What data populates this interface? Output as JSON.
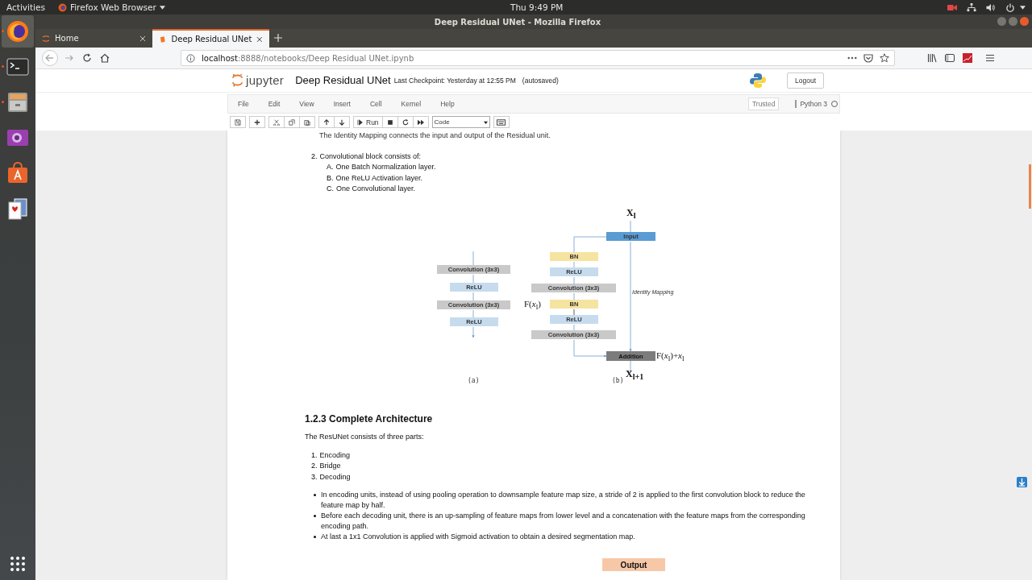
{
  "topbar": {
    "activities": "Activities",
    "app_menu": "Firefox Web Browser",
    "clock": "Thu  9:49 PM"
  },
  "dock": [
    {
      "kind": "firefox",
      "selected": true,
      "running": true
    },
    {
      "kind": "terminal",
      "selected": false,
      "running": true
    },
    {
      "kind": "files",
      "selected": false,
      "running": true
    },
    {
      "kind": "video",
      "selected": false,
      "running": false
    },
    {
      "kind": "software",
      "selected": false,
      "running": false
    },
    {
      "kind": "cards",
      "selected": false,
      "running": false
    }
  ],
  "window": {
    "title": "Deep Residual UNet - Mozilla Firefox"
  },
  "tabs": [
    {
      "label": "Home",
      "selected": false
    },
    {
      "label": "Deep Residual UNet",
      "selected": true
    }
  ],
  "address": {
    "host": "localhost",
    "path": ":8888/notebooks/Deep Residual UNet.ipynb"
  },
  "jupyter": {
    "logo_text": "jupyter",
    "notebook_name": "Deep Residual UNet",
    "checkpoint": "Last Checkpoint: Yesterday at 12:55 PM",
    "autosave": "(autosaved)",
    "logout": "Logout",
    "menus": [
      "File",
      "Edit",
      "View",
      "Insert",
      "Cell",
      "Kernel",
      "Help"
    ],
    "trusted": "Trusted",
    "kernel": "Python 3",
    "run": "Run",
    "cell_type": "Code"
  },
  "notebook": {
    "intro": "The Identity Mapping connects the input and output of the Residual unit.",
    "item2": {
      "number": "2.",
      "text": "Convolutional block consists of:",
      "subitems": [
        {
          "mark": "A.",
          "text": "One Batch Normalization layer."
        },
        {
          "mark": "B.",
          "text": "One ReLU Activation layer."
        },
        {
          "mark": "C.",
          "text": "One Convolutional layer."
        }
      ]
    },
    "diagram": {
      "panel_a": {
        "caption": "(a)",
        "blocks": [
          {
            "kind": "conv",
            "label": "Convolution (3x3)"
          },
          {
            "kind": "relu",
            "label": "ReLU"
          },
          {
            "kind": "conv",
            "label": "Convolution (3x3)"
          },
          {
            "kind": "relu",
            "label": "ReLU"
          }
        ]
      },
      "panel_b": {
        "caption": "(b)",
        "input_symbol": "X$_{l}$",
        "input": "Input",
        "residual_label": "F(*x*$_{l}$)",
        "identity_label": "Identity Mapping",
        "addition": "Addition",
        "sum_label": "F(*x*$_{l}$)+*x*$_{l}$",
        "output_symbol": "X$_{l+1}$",
        "blocks": [
          {
            "kind": "bn",
            "label": "BN"
          },
          {
            "kind": "relu",
            "label": "ReLU"
          },
          {
            "kind": "conv",
            "label": "Convolution (3x3)"
          },
          {
            "kind": "bn",
            "label": "BN"
          },
          {
            "kind": "relu",
            "label": "ReLU"
          },
          {
            "kind": "conv",
            "label": "Convolution (3x3)"
          }
        ]
      }
    },
    "heading": "1.2.3 Complete Architecture",
    "paragraph": "The ResUNet consists of three parts:",
    "parts": [
      {
        "number": "1.",
        "text": "Encoding"
      },
      {
        "number": "2.",
        "text": "Bridge"
      },
      {
        "number": "3.",
        "text": "Decoding"
      }
    ],
    "bullets": [
      "In encoding units, instead of using pooling operation to downsample feature map size, a stride of 2 is applied to the first convolution block to reduce the feature map by half.",
      "Before each decoding unit, there is an up-sampling of feature maps from lower level and a concatenation with the feature maps from the corresponding encoding path.",
      "At last a 1x1 Convolution is applied with Sigmoid activation to obtain a desired segmentation map."
    ],
    "output_block": "Output"
  }
}
